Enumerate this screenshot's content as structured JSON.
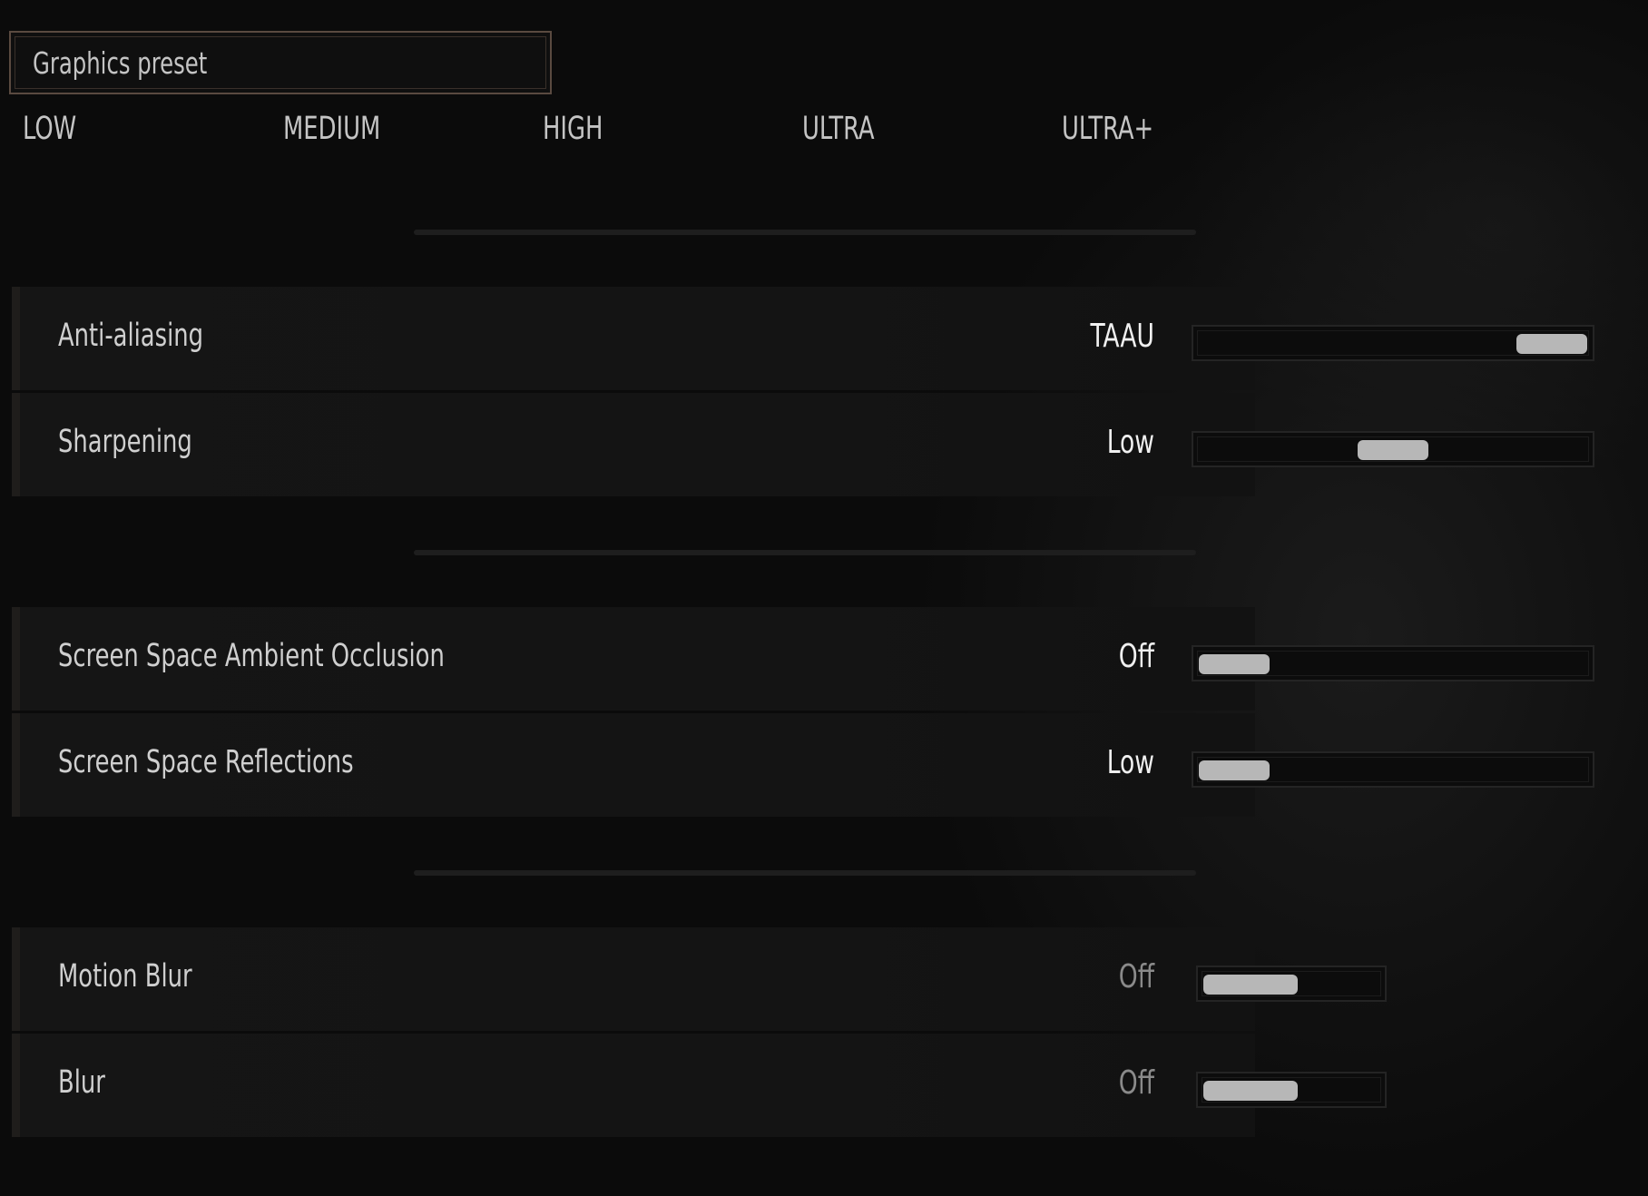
{
  "preset": {
    "title": "Graphics preset",
    "options": [
      "LOW",
      "MEDIUM",
      "HIGH",
      "ULTRA",
      "ULTRA+"
    ]
  },
  "settings": {
    "anti_aliasing": {
      "label": "Anti-aliasing",
      "value": "TAAU",
      "position": 1.0
    },
    "sharpening": {
      "label": "Sharpening",
      "value": "Low",
      "position": 0.5
    },
    "ssao": {
      "label": "Screen Space Ambient Occlusion",
      "value": "Off",
      "position": 0.0
    },
    "ssr": {
      "label": "Screen Space Reflections",
      "value": "Low",
      "position": 0.0
    },
    "motion_blur": {
      "label": "Motion Blur",
      "value": "Off",
      "position": 0.0
    },
    "blur": {
      "label": "Blur",
      "value": "Off",
      "position": 0.0
    }
  },
  "colors": {
    "background": "#0b0b0b",
    "row_background": "#151515",
    "accent_border": "#5a4a40",
    "thumb": "#b7b7b7",
    "value_active": "#f0f0f0",
    "value_disabled": "#8a8a8a"
  }
}
